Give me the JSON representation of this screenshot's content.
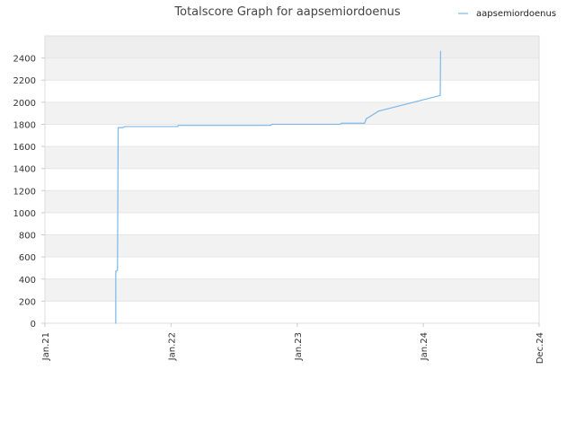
{
  "chart_data": {
    "type": "line",
    "title": "Totalscore Graph for aapsemiordoenus",
    "xlabel": "",
    "ylabel": "",
    "x_ticks": [
      "Jan.21",
      "Jan.22",
      "Jan.23",
      "Jan.24",
      "Dec.24"
    ],
    "x_range": [
      "2021-01-01",
      "2024-12-01"
    ],
    "y_ticks": [
      0,
      200,
      400,
      600,
      800,
      1000,
      1200,
      1400,
      1600,
      1800,
      2000,
      2200,
      2400
    ],
    "ylim": [
      0,
      2400
    ],
    "grid": true,
    "legend_position": "top-right",
    "series": [
      {
        "name": "aapsemiordoenus",
        "color": "#7cb7ea",
        "points": [
          {
            "x": "2021-07-25",
            "y": 0
          },
          {
            "x": "2021-07-25",
            "y": 470
          },
          {
            "x": "2021-07-30",
            "y": 480
          },
          {
            "x": "2021-08-01",
            "y": 1770
          },
          {
            "x": "2021-08-15",
            "y": 1770
          },
          {
            "x": "2021-08-20",
            "y": 1780
          },
          {
            "x": "2022-01-20",
            "y": 1780
          },
          {
            "x": "2022-01-22",
            "y": 1790
          },
          {
            "x": "2022-10-15",
            "y": 1790
          },
          {
            "x": "2022-10-20",
            "y": 1800
          },
          {
            "x": "2023-05-05",
            "y": 1800
          },
          {
            "x": "2023-05-10",
            "y": 1810
          },
          {
            "x": "2023-07-15",
            "y": 1810
          },
          {
            "x": "2023-07-20",
            "y": 1850
          },
          {
            "x": "2023-08-25",
            "y": 1920
          },
          {
            "x": "2024-02-18",
            "y": 2060
          },
          {
            "x": "2024-02-19",
            "y": 2060
          },
          {
            "x": "2024-02-20",
            "y": 2460
          }
        ]
      }
    ]
  }
}
